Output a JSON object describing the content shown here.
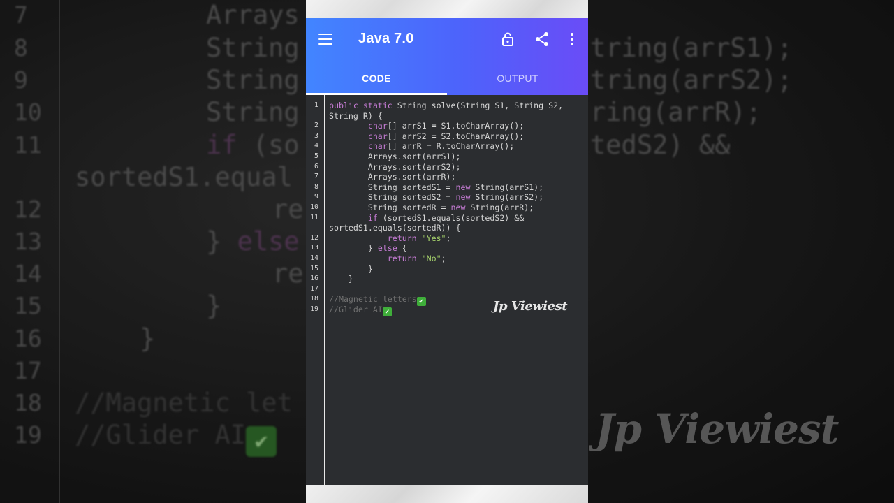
{
  "app": {
    "title": "Java 7.0",
    "accent_start": "#4285ff",
    "accent_end": "#6a4cf7",
    "icons": [
      "menu-icon",
      "lock-icon",
      "share-icon",
      "more-vert-icon"
    ]
  },
  "tabs": [
    {
      "label": "CODE",
      "active": true
    },
    {
      "label": "OUTPUT",
      "active": false
    }
  ],
  "code": {
    "line_numbers": [
      "1",
      "2",
      "3",
      "4",
      "5",
      "6",
      "7",
      "8",
      "9",
      "10",
      "11",
      "12",
      "13",
      "14",
      "15",
      "16",
      "17",
      "18",
      "19"
    ],
    "rows": [
      {
        "ln": "1",
        "parts": [
          {
            "t": "public static ",
            "c": "kw"
          },
          {
            "t": "String solve(String S1, String S2,"
          }
        ]
      },
      {
        "ln": "",
        "parts": [
          {
            "t": "String R) {"
          }
        ]
      },
      {
        "ln": "2",
        "parts": [
          {
            "t": "        "
          },
          {
            "t": "char",
            "c": "kw"
          },
          {
            "t": "[] arrS1 = S1.toCharArray();"
          }
        ]
      },
      {
        "ln": "3",
        "parts": [
          {
            "t": "        "
          },
          {
            "t": "char",
            "c": "kw"
          },
          {
            "t": "[] arrS2 = S2.toCharArray();"
          }
        ]
      },
      {
        "ln": "4",
        "parts": [
          {
            "t": "        "
          },
          {
            "t": "char",
            "c": "kw"
          },
          {
            "t": "[] arrR = R.toCharArray();"
          }
        ]
      },
      {
        "ln": "5",
        "parts": [
          {
            "t": "        Arrays.sort(arrS1);"
          }
        ]
      },
      {
        "ln": "6",
        "parts": [
          {
            "t": "        Arrays.sort(arrS2);"
          }
        ]
      },
      {
        "ln": "7",
        "parts": [
          {
            "t": "        Arrays.sort(arrR);"
          }
        ]
      },
      {
        "ln": "8",
        "parts": [
          {
            "t": "        String sortedS1 = "
          },
          {
            "t": "new",
            "c": "kw"
          },
          {
            "t": " String(arrS1);"
          }
        ]
      },
      {
        "ln": "9",
        "parts": [
          {
            "t": "        String sortedS2 = "
          },
          {
            "t": "new",
            "c": "kw"
          },
          {
            "t": " String(arrS2);"
          }
        ]
      },
      {
        "ln": "10",
        "parts": [
          {
            "t": "        String sortedR = "
          },
          {
            "t": "new",
            "c": "kw"
          },
          {
            "t": " String(arrR);"
          }
        ]
      },
      {
        "ln": "11",
        "parts": [
          {
            "t": "        "
          },
          {
            "t": "if",
            "c": "kw"
          },
          {
            "t": " (sortedS1.equals(sortedS2) &&"
          }
        ]
      },
      {
        "ln": "",
        "parts": [
          {
            "t": "sortedS1.equals(sortedR)) {"
          }
        ]
      },
      {
        "ln": "12",
        "parts": [
          {
            "t": "            "
          },
          {
            "t": "return",
            "c": "kw"
          },
          {
            "t": " "
          },
          {
            "t": "\"Yes\"",
            "c": "str"
          },
          {
            "t": ";"
          }
        ]
      },
      {
        "ln": "13",
        "parts": [
          {
            "t": "        } "
          },
          {
            "t": "else",
            "c": "kw"
          },
          {
            "t": " {"
          }
        ]
      },
      {
        "ln": "14",
        "parts": [
          {
            "t": "            "
          },
          {
            "t": "return",
            "c": "kw"
          },
          {
            "t": " "
          },
          {
            "t": "\"No\"",
            "c": "str"
          },
          {
            "t": ";"
          }
        ]
      },
      {
        "ln": "15",
        "parts": [
          {
            "t": "        }"
          }
        ]
      },
      {
        "ln": "16",
        "parts": [
          {
            "t": "    }"
          }
        ]
      },
      {
        "ln": "17",
        "parts": []
      },
      {
        "ln": "18",
        "parts": [
          {
            "t": "//Magnetic letters",
            "c": "cm"
          },
          {
            "t": "✔",
            "c": "check"
          }
        ]
      },
      {
        "ln": "19",
        "parts": [
          {
            "t": "//Glider AI",
            "c": "cm"
          },
          {
            "t": "✔",
            "c": "check"
          }
        ]
      }
    ],
    "colors": {
      "background": "#2b2d30",
      "keyword": "#c77dd6",
      "string": "#a8d56d",
      "comment": "#707070"
    }
  },
  "watermark": "Jp Viewiest",
  "background_zoom": {
    "rows": [
      {
        "ln": "7",
        "code": "Arrays"
      },
      {
        "ln": "8",
        "code": "String"
      },
      {
        "ln": "9",
        "code": "String"
      },
      {
        "ln": "10",
        "code": "String"
      },
      {
        "ln": "11",
        "code": "if (so",
        "kw": "if"
      },
      {
        "ln": "",
        "code": "sortedS1.equal"
      },
      {
        "ln": "12",
        "code": "re"
      },
      {
        "ln": "13",
        "code": "} else"
      },
      {
        "ln": "14",
        "code": "re"
      },
      {
        "ln": "15",
        "code": "}"
      },
      {
        "ln": "16",
        "code": "}"
      },
      {
        "ln": "17",
        "code": ""
      },
      {
        "ln": "18",
        "code": "//Magnetic let"
      },
      {
        "ln": "19",
        "code": "//Glider AI"
      }
    ],
    "right_rows": [
      "tring(arrS1);",
      "tring(arrS2);",
      "ring(arrR);",
      "tedS2) &&"
    ]
  }
}
